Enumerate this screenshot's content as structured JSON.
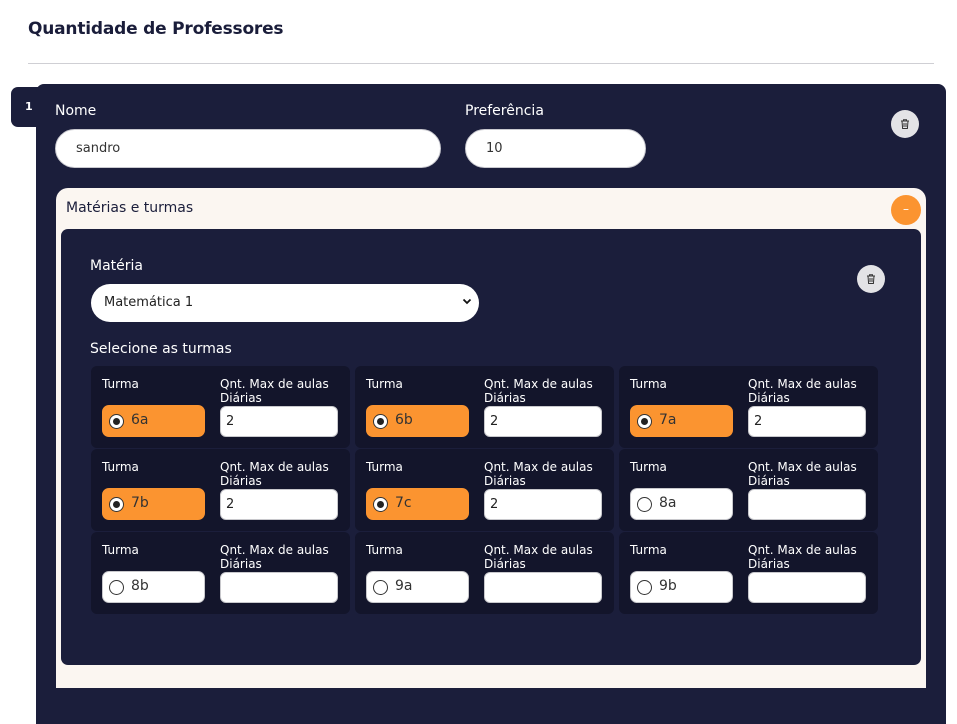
{
  "page": {
    "title": "Quantidade de Professores"
  },
  "teacher": {
    "index": "1",
    "name_label": "Nome",
    "name_value": "sandro",
    "pref_label": "Preferência",
    "pref_value": "10",
    "subjects_title": "Matérias e turmas",
    "collapse_symbol": "–"
  },
  "subject": {
    "materia_label": "Matéria",
    "materia_selected": "Matemática 1",
    "classes_label": "Selecione as turmas"
  },
  "classes": [
    {
      "turma_label": "Turma",
      "max_label_1": "Qnt. Max de aulas",
      "max_label_2": "Diárias",
      "name": "6a",
      "selected": true,
      "max": "2"
    },
    {
      "turma_label": "Turma",
      "max_label_1": "Qnt. Max de aulas",
      "max_label_2": "Diárias",
      "name": "6b",
      "selected": true,
      "max": "2"
    },
    {
      "turma_label": "Turma",
      "max_label_1": "Qnt. Max de aulas",
      "max_label_2": "Diárias",
      "name": "7a",
      "selected": true,
      "max": "2"
    },
    {
      "turma_label": "Turma",
      "max_label_1": "Qnt. Max de aulas",
      "max_label_2": "Diárias",
      "name": "7b",
      "selected": true,
      "max": "2"
    },
    {
      "turma_label": "Turma",
      "max_label_1": "Qnt. Max de aulas",
      "max_label_2": "Diárias",
      "name": "7c",
      "selected": true,
      "max": "2"
    },
    {
      "turma_label": "Turma",
      "max_label_1": "Qnt. Max de aulas",
      "max_label_2": "Diárias",
      "name": "8a",
      "selected": false,
      "max": ""
    },
    {
      "turma_label": "Turma",
      "max_label_1": "Qnt. Max de aulas",
      "max_label_2": "Diárias",
      "name": "8b",
      "selected": false,
      "max": ""
    },
    {
      "turma_label": "Turma",
      "max_label_1": "Qnt. Max de aulas",
      "max_label_2": "Diárias",
      "name": "9a",
      "selected": false,
      "max": ""
    },
    {
      "turma_label": "Turma",
      "max_label_1": "Qnt. Max de aulas",
      "max_label_2": "Diárias",
      "name": "9b",
      "selected": false,
      "max": ""
    }
  ],
  "colors": {
    "navy": "#1b1e3b",
    "orange": "#fb9430",
    "cream": "#fbf6f1"
  },
  "icons": {
    "delete": "trash-icon",
    "select": "chevron-down-icon",
    "radio": "radio-icon"
  }
}
